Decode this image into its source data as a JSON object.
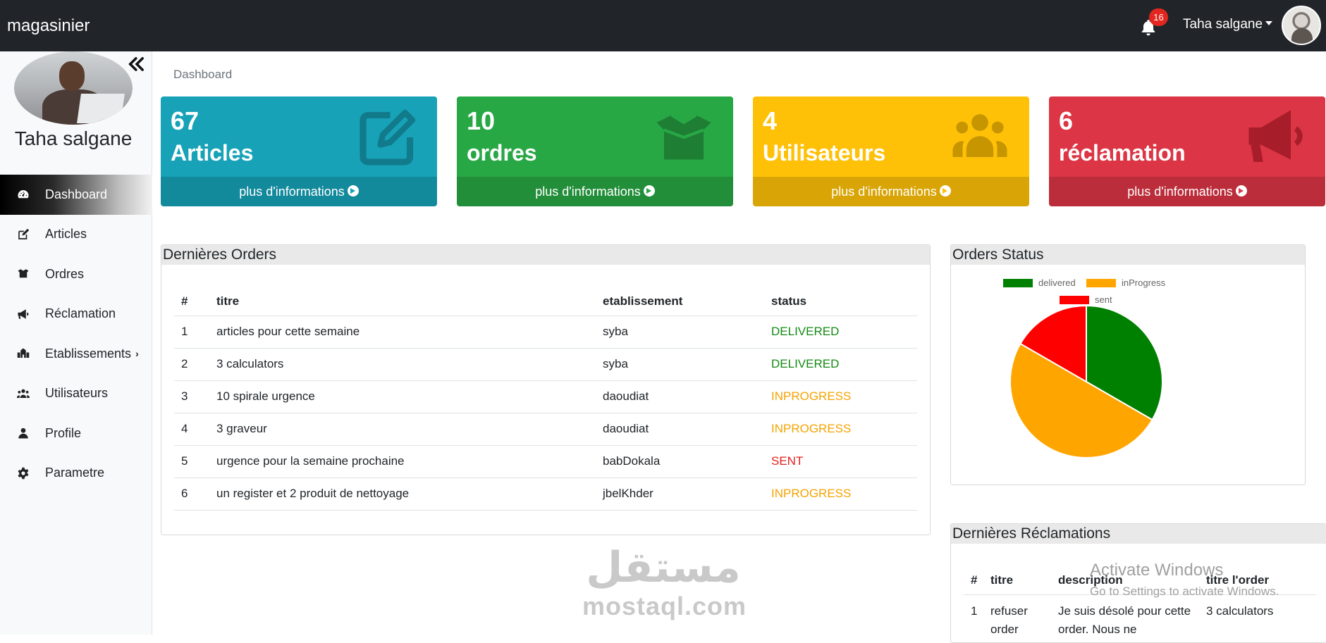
{
  "navbar": {
    "brand": "magasinier",
    "notification_count": "16",
    "user_name": "Taha salgane"
  },
  "sidebar": {
    "user_name": "Taha salgane",
    "items": [
      {
        "label": "Dashboard",
        "icon": "tachometer-icon",
        "active": true
      },
      {
        "label": "Articles",
        "icon": "edit-icon"
      },
      {
        "label": "Ordres",
        "icon": "box-open-icon"
      },
      {
        "label": "Réclamation",
        "icon": "bullhorn-icon"
      },
      {
        "label": "Etablissements",
        "icon": "school-icon",
        "has_submenu": true
      },
      {
        "label": "Utilisateurs",
        "icon": "users-icon"
      },
      {
        "label": "Profile",
        "icon": "user-icon"
      },
      {
        "label": "Parametre",
        "icon": "cog-icon"
      }
    ]
  },
  "breadcrumb": "Dashboard",
  "cards": [
    {
      "count": "67",
      "label": "Articles",
      "link": "plus d'informations",
      "color": "#17a2b8",
      "icon": "edit-icon"
    },
    {
      "count": "10",
      "label": "ordres",
      "link": "plus d'informations",
      "color": "#28a745",
      "icon": "box-open-icon"
    },
    {
      "count": "4",
      "label": "Utilisateurs",
      "link": "plus d'informations",
      "color": "#ffc107",
      "icon": "users-icon"
    },
    {
      "count": "6",
      "label": "réclamation",
      "link": "plus d'informations",
      "color": "#dc3545",
      "icon": "bullhorn-icon"
    }
  ],
  "orders": {
    "title": "Dernières Orders",
    "columns": [
      "#",
      "titre",
      "etablissement",
      "status"
    ],
    "rows": [
      {
        "id": "1",
        "titre": "articles pour cette semaine",
        "etablissement": "syba",
        "status": "DELIVERED"
      },
      {
        "id": "2",
        "titre": "3 calculators",
        "etablissement": "syba",
        "status": "DELIVERED"
      },
      {
        "id": "3",
        "titre": "10 spirale urgence",
        "etablissement": "daoudiat",
        "status": "INPROGRESS"
      },
      {
        "id": "4",
        "titre": "3 graveur",
        "etablissement": "daoudiat",
        "status": "INPROGRESS"
      },
      {
        "id": "5",
        "titre": "urgence pour la semaine prochaine",
        "etablissement": "babDokala",
        "status": "SENT"
      },
      {
        "id": "6",
        "titre": "un register et 2 produit de nettoyage",
        "etablissement": "jbelKhder",
        "status": "INPROGRESS"
      }
    ]
  },
  "status_colors": {
    "DELIVERED": "#138a13",
    "INPROGRESS": "#f5a300",
    "SENT": "#e3201b"
  },
  "orders_status": {
    "title": "Orders Status",
    "chart_data": {
      "type": "pie",
      "title": "",
      "categories": [
        "delivered",
        "inProgress",
        "sent"
      ],
      "values": [
        2,
        3,
        1
      ],
      "colors": [
        "#008000",
        "#ffa500",
        "#ff0000"
      ],
      "legend": "top"
    }
  },
  "reclamations": {
    "title": "Dernières Réclamations",
    "columns": [
      "#",
      "titre",
      "description",
      "titre l'order"
    ],
    "rows": [
      {
        "id": "1",
        "titre": "refuser order",
        "description": "Je suis désolé pour cette order. Nous ne",
        "order": "3 calculators"
      }
    ]
  },
  "watermark": {
    "line1": "Activate Windows",
    "line2": "Go to Settings to activate Windows.",
    "logo_ar": "مستقل",
    "logo_en": "mostaql.com"
  }
}
